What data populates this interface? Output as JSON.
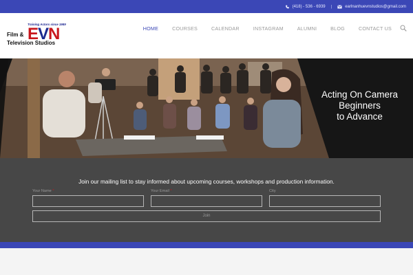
{
  "topbar": {
    "phone": "(418) - 536 - 6939",
    "separator": "|",
    "email": "earlnanhuevnstudios@gmail.com"
  },
  "logo": {
    "tagline": "Training Actors since 1989",
    "mark": {
      "e": "E",
      "v": "V",
      "n": "N"
    },
    "name_line1": "Film &",
    "name_line2": "Television Studios"
  },
  "nav": {
    "items": [
      {
        "label": "HOME",
        "active": true
      },
      {
        "label": "COURSES",
        "active": false
      },
      {
        "label": "CALENDAR",
        "active": false
      },
      {
        "label": "INSTAGRAM",
        "active": false
      },
      {
        "label": "ALUMNI",
        "active": false
      },
      {
        "label": "BLOG",
        "active": false
      },
      {
        "label": "CONTACT US",
        "active": false
      }
    ],
    "search_icon": "search-icon"
  },
  "hero": {
    "line1": "Acting On Camera",
    "line2": "Beginners",
    "line3": "to Advance"
  },
  "mailing": {
    "message": "Join our mailing list to stay informed about upcoming courses, workshops and production information.",
    "name_label": "Your Name",
    "email_label": "Your Email",
    "city_label": "City",
    "required_mark": "*",
    "join_label": "Join"
  },
  "colors": {
    "brand_blue": "#3b47b6",
    "brand_red": "#c8161d",
    "panel_gray": "#474747"
  }
}
